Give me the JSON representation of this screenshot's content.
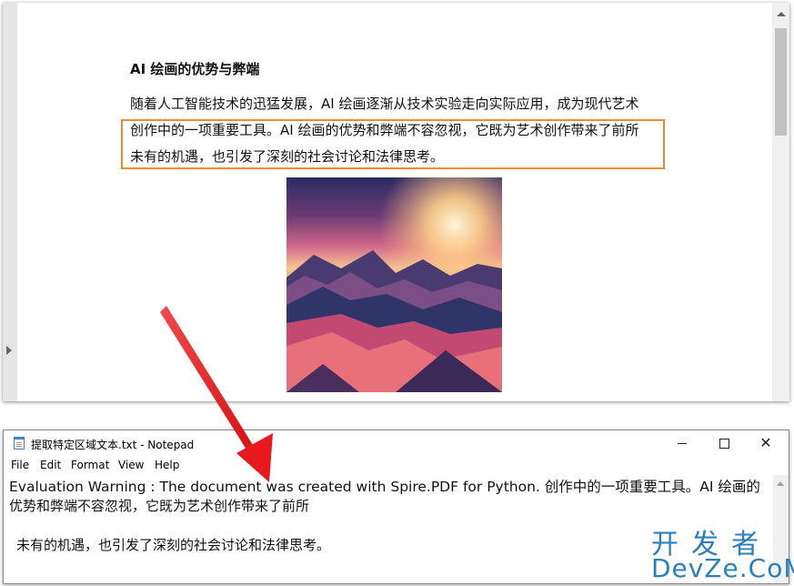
{
  "viewer": {
    "doc_title": "AI 绘画的优势与弊端",
    "paragraph_lines": [
      "随着人工智能技术的迅猛发展，AI 绘画逐渐从技术实验走向实际应用，成为现代艺术",
      "创作中的一项重要工具。AI 绘画的优势和弊端不容忽视，它既为艺术创作带来了前所",
      "未有的机遇，也引发了深刻的社会讨论和法律思考。"
    ],
    "highlight_color": "#ef8b2c"
  },
  "notepad": {
    "window_title": "提取特定区域文本.txt - Notepad",
    "menu": [
      "File",
      "Edit",
      "Format",
      "View",
      "Help"
    ],
    "controls": {
      "minimize": "—",
      "maximize": "☐",
      "close": "✕"
    },
    "lines": [
      "Evaluation Warning : The document was created with Spire.PDF for Python.  创作中的一项重要工具。AI 绘画的",
      "优势和弊端不容忽视，它既为艺术创作带来了前所",
      " 未有的机遇，也引发了深刻的社会讨论和法律思考。"
    ]
  },
  "annotation": {
    "arrow_color": "#e8191c"
  },
  "watermark": {
    "cn": "开发者",
    "en": "DevZe.CoM",
    "color": "#2c7fbf"
  }
}
